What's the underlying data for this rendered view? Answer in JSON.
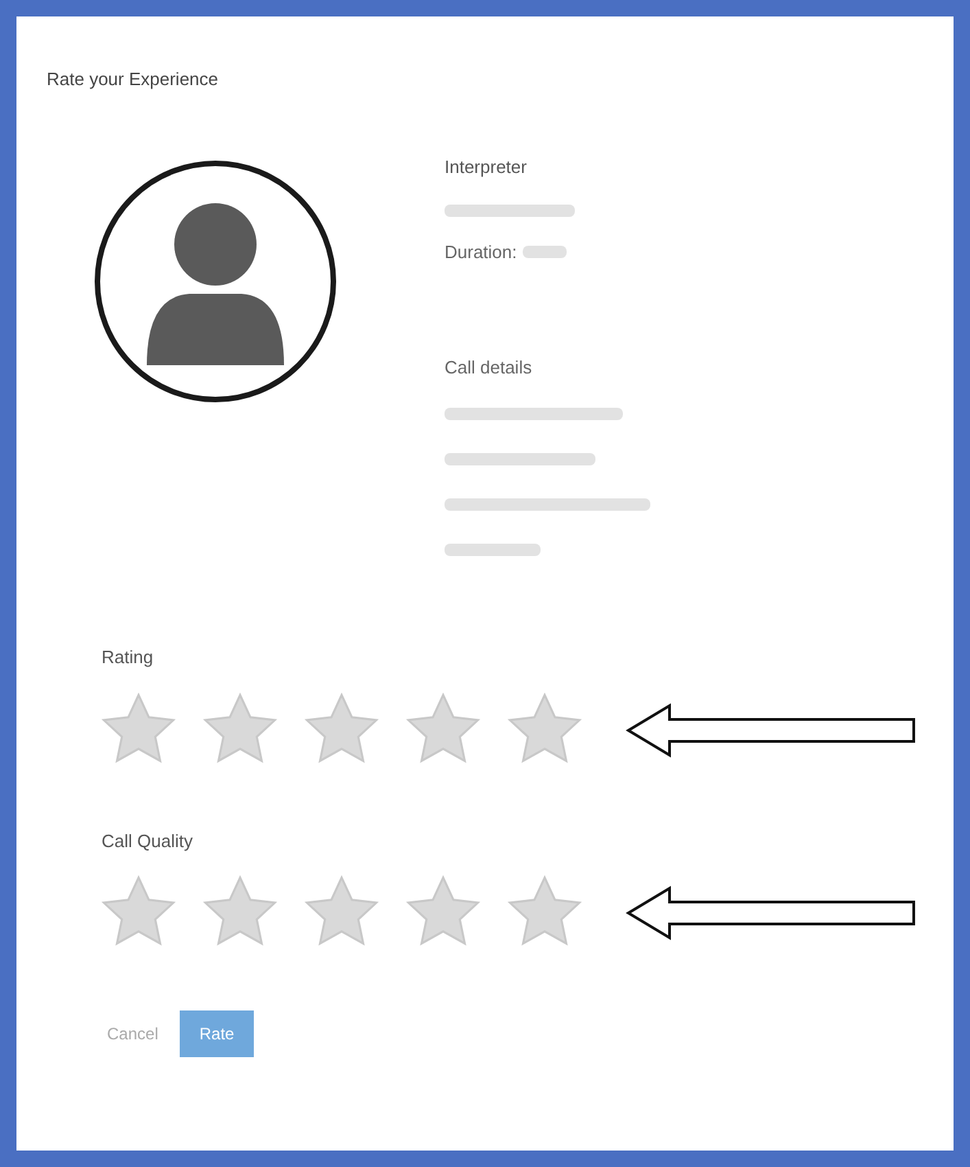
{
  "dialog": {
    "title": "Rate your Experience"
  },
  "interpreter": {
    "heading": "Interpreter",
    "duration_label": "Duration:"
  },
  "call_details": {
    "heading": "Call details"
  },
  "ratings": [
    {
      "label": "Rating",
      "stars": 0
    },
    {
      "label": "Call Quality",
      "stars": 0
    }
  ],
  "buttons": [
    {
      "label": "Cancel",
      "kind": "link"
    },
    {
      "label": "Rate",
      "kind": "primary"
    }
  ]
}
